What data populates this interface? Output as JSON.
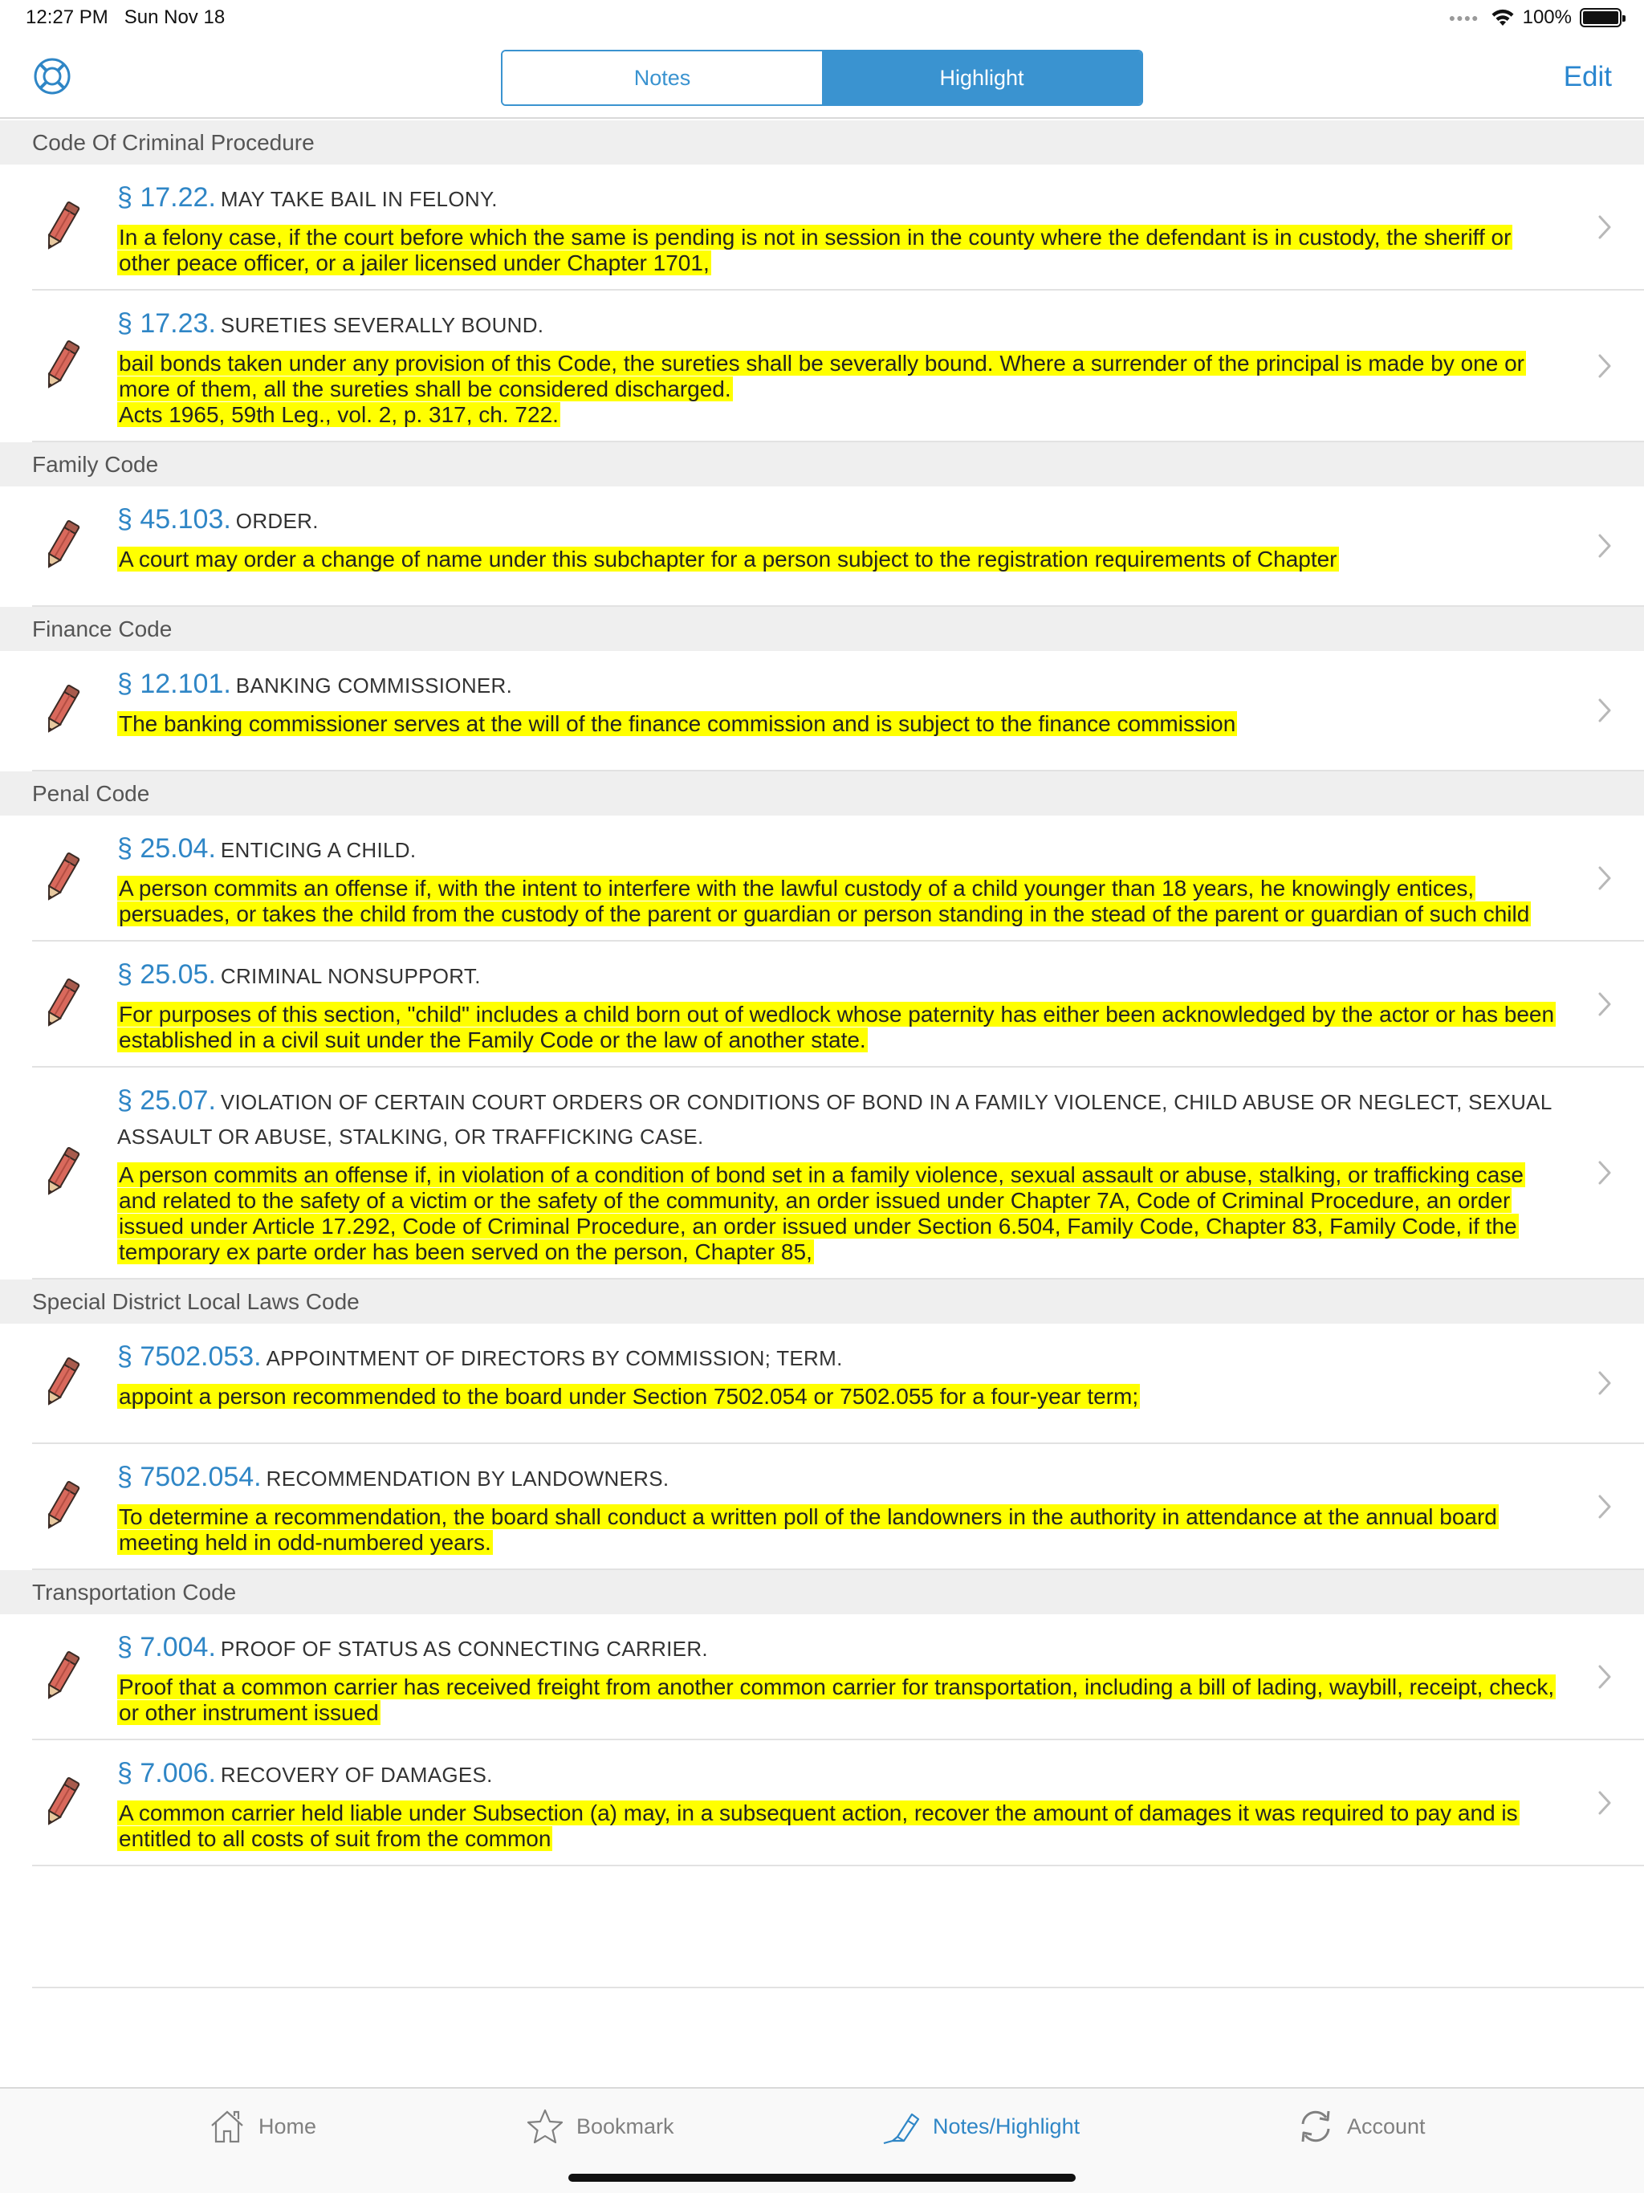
{
  "status_bar": {
    "time": "12:27 PM",
    "date": "Sun Nov 18",
    "battery": "100%"
  },
  "nav": {
    "segments": [
      {
        "label": "Notes",
        "active": false
      },
      {
        "label": "Highlight",
        "active": true
      }
    ],
    "edit_label": "Edit"
  },
  "sections": [
    {
      "title": "Code Of Criminal Procedure",
      "items": [
        {
          "num": "§ 17.22.",
          "name": "MAY TAKE BAIL IN FELONY.",
          "text": "In a felony case, if the court before which the same is pending is not in session in the county where the defendant is in custody, the sheriff or other peace officer, or a jailer licensed under Chapter 1701,"
        },
        {
          "num": "§ 17.23.",
          "name": "SURETIES SEVERALLY BOUND.",
          "text": "bail bonds taken under any provision of this Code, the sureties shall be severally bound. Where a surrender of the principal is made by one or more of them, all the sureties shall be considered discharged.\nActs 1965, 59th Leg., vol. 2, p. 317, ch. 722."
        }
      ]
    },
    {
      "title": "Family Code",
      "items": [
        {
          "num": "§ 45.103.",
          "name": "ORDER.",
          "text": "A court may order a change of name under this subchapter for a person subject to the registration requirements of Chapter"
        }
      ]
    },
    {
      "title": "Finance Code",
      "items": [
        {
          "num": "§ 12.101.",
          "name": "BANKING COMMISSIONER.",
          "text": "The banking commissioner serves at the will of the finance commission and is subject to the finance commission"
        }
      ]
    },
    {
      "title": "Penal Code",
      "items": [
        {
          "num": "§ 25.04.",
          "name": "ENTICING A CHILD.",
          "text": "A person commits an offense if, with the intent to interfere with the lawful custody of a child younger than 18 years, he knowingly entices, persuades, or takes the child from the custody of the parent or guardian or person standing in the stead of the parent or guardian of such child"
        },
        {
          "num": "§ 25.05.",
          "name": "CRIMINAL NONSUPPORT.",
          "text": "For purposes of this section, \"child\" includes a child born out of wedlock whose paternity has either been acknowledged by the actor or has been established in a civil suit under the Family Code or the law of another state."
        },
        {
          "num": "§ 25.07.",
          "name": "VIOLATION OF CERTAIN COURT ORDERS OR CONDITIONS OF BOND IN A FAMILY VIOLENCE, CHILD ABUSE OR NEGLECT, SEXUAL ASSAULT OR ABUSE, STALKING, OR TRAFFICKING CASE.",
          "text": "A person commits an offense if, in violation of a condition of bond set in a family violence, sexual assault or abuse, stalking, or trafficking case and related to the safety of a victim or the safety of the community, an order issued under Chapter 7A, Code of Criminal Procedure, an order issued under Article 17.292, Code of Criminal Procedure, an order issued under Section 6.504, Family Code, Chapter 83, Family Code, if the temporary ex parte order has been served on the person, Chapter 85,"
        }
      ]
    },
    {
      "title": "Special District Local Laws Code",
      "items": [
        {
          "num": "§ 7502.053.",
          "name": "APPOINTMENT OF DIRECTORS BY COMMISSION; TERM.",
          "text": "appoint a person recommended to the board under Section 7502.054 or 7502.055 for a four-year term;"
        },
        {
          "num": "§ 7502.054.",
          "name": "RECOMMENDATION BY LANDOWNERS.",
          "text": "To determine a recommendation, the board shall conduct a written poll of the landowners in the authority in attendance at the annual board meeting held in odd-numbered years."
        }
      ]
    },
    {
      "title": "Transportation Code",
      "items": [
        {
          "num": "§ 7.004.",
          "name": "PROOF OF STATUS AS CONNECTING CARRIER.",
          "text": "Proof that a common carrier has received freight from another common carrier for transportation, including a bill of lading, waybill, receipt, check, or other instrument issued"
        },
        {
          "num": "§ 7.006.",
          "name": "RECOVERY OF DAMAGES.",
          "text": "A common carrier held liable under Subsection (a) may, in a subsequent action, recover the amount of damages it was required to pay and is entitled to all costs of suit from the common"
        }
      ]
    }
  ],
  "tabs": [
    {
      "label": "Home",
      "icon": "home-icon",
      "active": false
    },
    {
      "label": "Bookmark",
      "icon": "star-icon",
      "active": false
    },
    {
      "label": "Notes/Highlight",
      "icon": "highlighter-icon",
      "active": true
    },
    {
      "label": "Account",
      "icon": "refresh-icon",
      "active": false
    }
  ],
  "colors": {
    "accent": "#3a93d0",
    "highlight": "#ffff00",
    "section_bg": "#efefef"
  }
}
